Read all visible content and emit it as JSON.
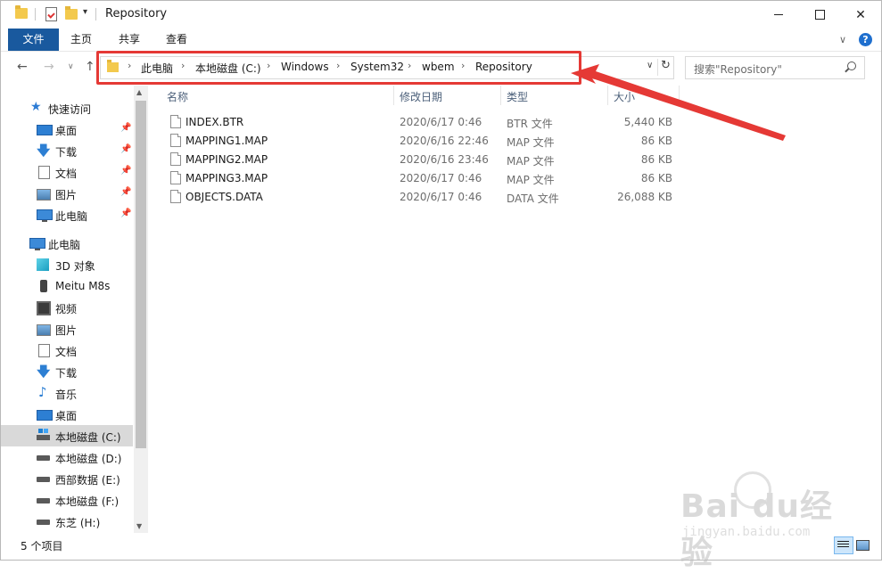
{
  "window": {
    "title": "Repository",
    "qa_dropdown": "▾",
    "min": "",
    "max": "",
    "close": "✕"
  },
  "ribbon": {
    "tabs": [
      "文件",
      "主页",
      "共享",
      "查看"
    ],
    "expand": "∨",
    "help": "?"
  },
  "nav": {
    "back": "←",
    "forward": "→",
    "recent": "∨",
    "up": "↑",
    "breadcrumbs": [
      "此电脑",
      "本地磁盘 (C:)",
      "Windows",
      "System32",
      "wbem",
      "Repository"
    ],
    "separator": "›",
    "dropdown": "∨",
    "refresh": "↻",
    "search_placeholder": "搜索\"Repository\""
  },
  "sidebar": {
    "pin": "📌",
    "quick_access": {
      "label": "快速访问",
      "icon": "star-icon",
      "items": [
        {
          "label": "桌面",
          "icon": "desktop-icon",
          "pinned": true
        },
        {
          "label": "下载",
          "icon": "download-icon",
          "pinned": true
        },
        {
          "label": "文档",
          "icon": "document-icon",
          "pinned": true
        },
        {
          "label": "图片",
          "icon": "picture-icon",
          "pinned": true
        },
        {
          "label": "此电脑",
          "icon": "computer-icon",
          "pinned": true
        }
      ]
    },
    "this_pc": {
      "label": "此电脑",
      "icon": "computer-icon",
      "items": [
        {
          "label": "3D 对象",
          "icon": "3d-objects-icon"
        },
        {
          "label": "Meitu M8s",
          "icon": "phone-icon"
        },
        {
          "label": "视频",
          "icon": "video-icon"
        },
        {
          "label": "图片",
          "icon": "picture-icon"
        },
        {
          "label": "文档",
          "icon": "document-icon"
        },
        {
          "label": "下载",
          "icon": "download-icon"
        },
        {
          "label": "音乐",
          "icon": "music-icon"
        },
        {
          "label": "桌面",
          "icon": "desktop-icon"
        },
        {
          "label": "本地磁盘 (C:)",
          "icon": "drive-c-icon",
          "selected": true
        },
        {
          "label": "本地磁盘 (D:)",
          "icon": "drive-icon"
        },
        {
          "label": "西部数据 (E:)",
          "icon": "drive-icon"
        },
        {
          "label": "本地磁盘 (F:)",
          "icon": "drive-icon"
        },
        {
          "label": "东芝 (H:)",
          "icon": "drive-icon"
        }
      ]
    }
  },
  "columns": {
    "name": "名称",
    "date": "修改日期",
    "type": "类型",
    "size": "大小",
    "sort_indicator": "^"
  },
  "files": [
    {
      "name": "INDEX.BTR",
      "date": "2020/6/17 0:46",
      "type": "BTR 文件",
      "size": "5,440 KB"
    },
    {
      "name": "MAPPING1.MAP",
      "date": "2020/6/16 22:46",
      "type": "MAP 文件",
      "size": "86 KB"
    },
    {
      "name": "MAPPING2.MAP",
      "date": "2020/6/16 23:46",
      "type": "MAP 文件",
      "size": "86 KB"
    },
    {
      "name": "MAPPING3.MAP",
      "date": "2020/6/17 0:46",
      "type": "MAP 文件",
      "size": "86 KB"
    },
    {
      "name": "OBJECTS.DATA",
      "date": "2020/6/17 0:46",
      "type": "DATA 文件",
      "size": "26,088 KB"
    }
  ],
  "status": {
    "item_count": "5 个项目"
  },
  "watermark": {
    "brand": "Bai du经验",
    "url": "jingyan.baidu.com"
  },
  "colors": {
    "file_tab": "#19599e",
    "annotation": "#e53935",
    "selected_item": "#d9d9d9"
  }
}
